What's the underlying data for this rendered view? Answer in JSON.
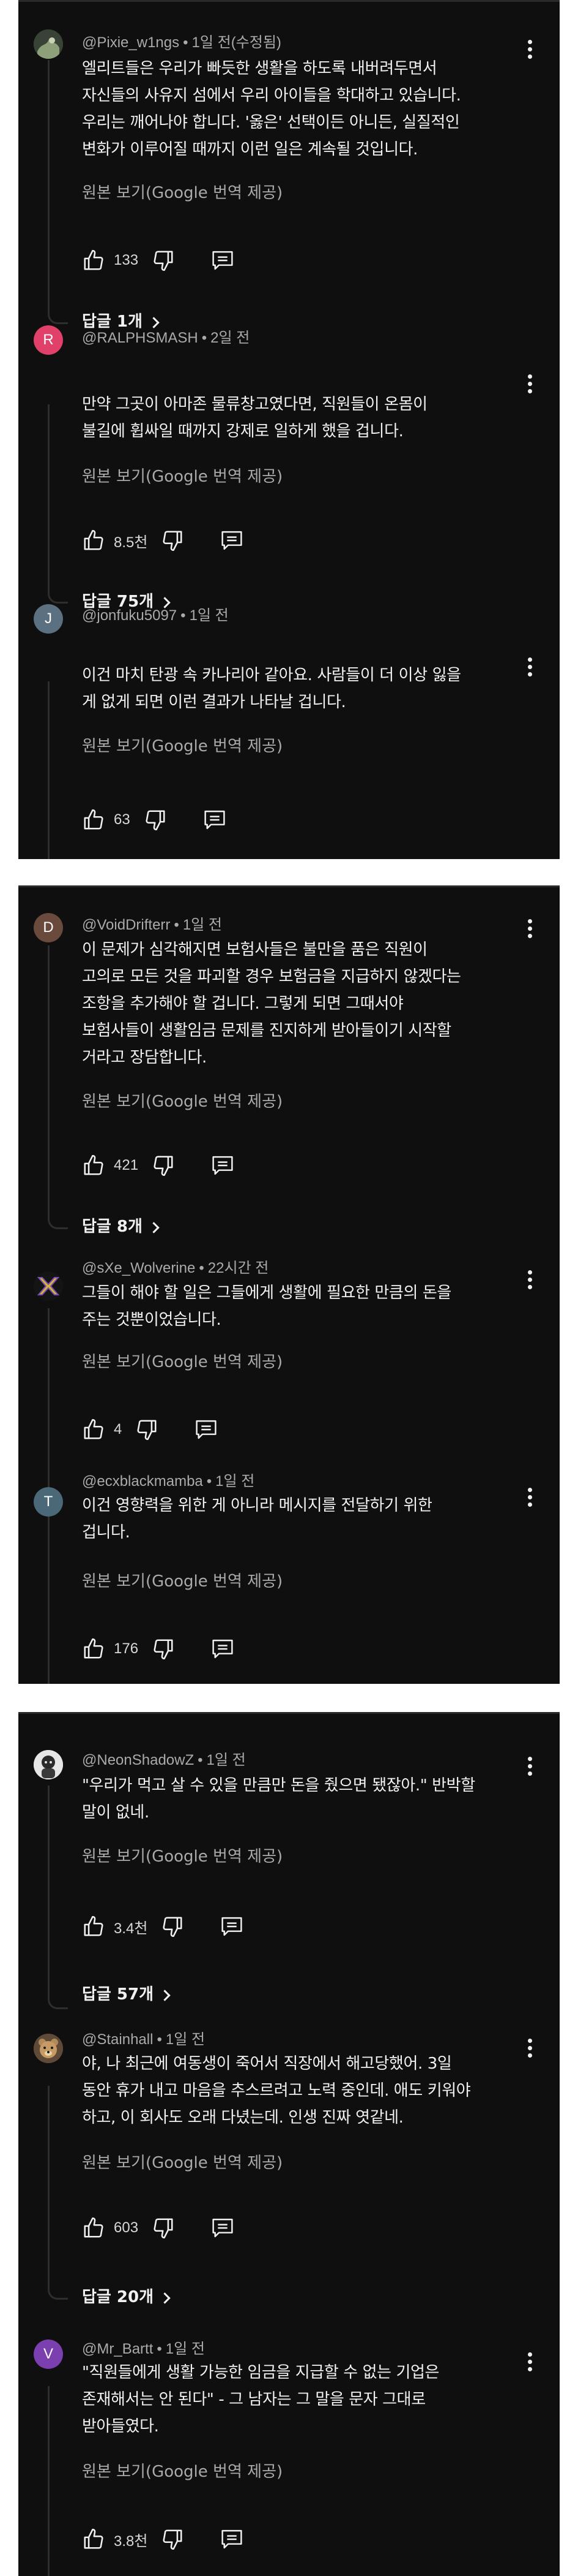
{
  "translate_label": "원본 보기(Google 번역 제공)",
  "colors": {
    "background": "#0f0f0f",
    "text": "#f1f1f1",
    "meta": "#aaaaaa",
    "avatar_R": "#e0406a",
    "avatar_J": "#5b7080",
    "avatar_D": "#6a4a3c",
    "avatar_T": "#4a6878",
    "avatar_V": "#7b3fb0"
  },
  "comments": [
    {
      "handle": "@Pixie_w1ngs",
      "time": "1일 전(수정됨)",
      "text": "엘리트들은 우리가 빠듯한 생활을 하도록 내버려두면서\n자신들의 사유지 섬에서 우리 아이들을 학대하고 있습니다.\n우리는 깨어나야 합니다. '옳은' 선택이든 아니든, 실질적인\n변화가 이루어질 때까지 이런 일은 계속될 것입니다.",
      "likes": "133",
      "replies": "답글 1개",
      "avatar_icon": "pixie-avatar-icon"
    },
    {
      "handle": "@RALPHSMASH",
      "time": "2일 전",
      "text": "만약 그곳이 아마존 물류창고였다면, 직원들이 온몸이\n불길에 휩싸일 때까지 강제로 일하게 했을 겁니다.",
      "likes": "8.5천",
      "replies": "답글 75개",
      "avatar_letter": "R"
    },
    {
      "handle": "@jonfuku5097",
      "time": "1일 전",
      "text": "이건 마치 탄광 속 카나리아 같아요. 사람들이 더 이상 잃을\n게 없게 되면 이런 결과가 나타날 겁니다.",
      "likes": "63",
      "avatar_letter": "J"
    },
    {
      "handle": "@VoidDrifterr",
      "time": "1일 전",
      "text": "이 문제가 심각해지면 보험사들은 불만을 품은 직원이\n고의로 모든 것을 파괴할 경우 보험금을 지급하지 않겠다는\n조항을 추가해야 할 겁니다. 그렇게 되면 그때서야\n보험사들이 생활임금 문제를 진지하게 받아들이기 시작할\n거라고 장담합니다.",
      "likes": "421",
      "replies": "답글 8개",
      "avatar_letter": "D"
    },
    {
      "handle": "@sXe_Wolverine",
      "time": "22시간 전",
      "text": "그들이 해야 할 일은 그들에게 생활에 필요한 만큼의 돈을\n주는 것뿐이었습니다.",
      "likes": "4",
      "avatar_icon": "sxe-x-logo-avatar-icon"
    },
    {
      "handle": "@ecxblackmamba",
      "time": "1일 전",
      "text": "이건 영향력을 위한 게 아니라 메시지를 전달하기 위한\n겁니다.",
      "likes": "176",
      "avatar_letter": "T"
    },
    {
      "handle": "@NeonShadowZ",
      "time": "1일 전",
      "text": "\"우리가 먹고 살 수 있을 만큼만 돈을 줬으면 됐잖아.\" 반박할\n말이 없네.",
      "likes": "3.4천",
      "replies": "답글 57개",
      "avatar_icon": "neon-character-avatar-icon"
    },
    {
      "handle": "@Stainhall",
      "time": "1일 전",
      "text": "야, 나 최근에 여동생이 죽어서 직장에서 해고당했어. 3일\n동안 휴가 내고 마음을 추스르려고 노력 중인데. 애도 키워야\n하고, 이 회사도 오래 다녔는데. 인생 진짜 엿같네.",
      "likes": "603",
      "replies": "답글 20개",
      "avatar_icon": "bear-avatar-icon"
    },
    {
      "handle": "@Mr_Bartt",
      "time": "1일 전",
      "text": "\"직원들에게 생활 가능한 임금을 지급할 수 없는 기업은\n존재해서는 안 된다\" - 그 남자는 그 말을 문자 그대로\n받아들였다.",
      "likes": "3.8천",
      "avatar_letter": "V"
    }
  ]
}
